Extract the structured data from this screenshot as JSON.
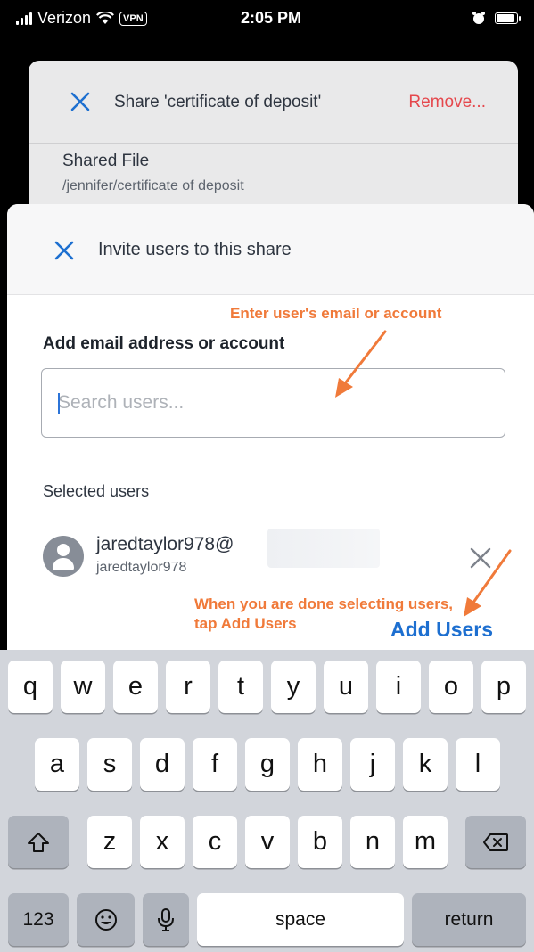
{
  "status_bar": {
    "carrier": "Verizon",
    "vpn": "VPN",
    "time": "2:05 PM"
  },
  "share_sheet": {
    "title": "Share 'certificate of deposit'",
    "remove_label": "Remove...",
    "shared_label": "Shared File",
    "shared_path": "/jennifer/certificate of deposit"
  },
  "invite_sheet": {
    "title": "Invite users to this share",
    "field_label": "Add email address or account",
    "search_placeholder": "Search users...",
    "selected_label": "Selected users",
    "selected_users": [
      {
        "email": "jaredtaylor978@",
        "handle": "jaredtaylor978"
      }
    ],
    "add_users_label": "Add Users"
  },
  "annotations": {
    "email_hint": "Enter user's email or account",
    "add_hint": "When you are done selecting users, tap Add Users"
  },
  "keyboard": {
    "row1": [
      "q",
      "w",
      "e",
      "r",
      "t",
      "y",
      "u",
      "i",
      "o",
      "p"
    ],
    "row2": [
      "a",
      "s",
      "d",
      "f",
      "g",
      "h",
      "j",
      "k",
      "l"
    ],
    "row3": [
      "z",
      "x",
      "c",
      "v",
      "b",
      "n",
      "m"
    ],
    "numbers_key": "123",
    "space_key": "space",
    "return_key": "return"
  },
  "colors": {
    "accent": "#1d6fd0",
    "remove": "#e5484d",
    "annotation": "#f07a3a",
    "keyboard_bg": "#d2d5db"
  }
}
